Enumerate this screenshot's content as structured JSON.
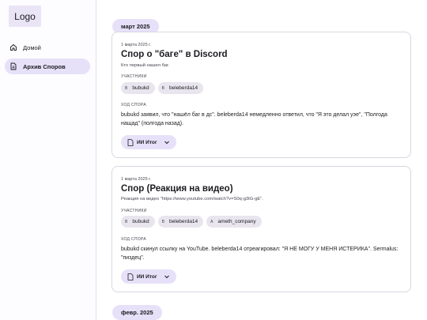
{
  "sidebar": {
    "logo": "Logo",
    "items": [
      {
        "label": "Домой",
        "icon": "home-icon"
      },
      {
        "label": "Архив Споров",
        "icon": "document-icon"
      }
    ]
  },
  "months": [
    "март 2025",
    "февр. 2025"
  ],
  "cards": [
    {
      "date": "1 марта 2025 г.",
      "title": "Спор о \"баге\" в Discord",
      "subtitle": "Кто первый нашел баг.",
      "participants_label": "УЧАСТНИКИ",
      "participants": [
        {
          "initial": "B",
          "name": "bubukd"
        },
        {
          "initial": "B",
          "name": "beleberda14"
        }
      ],
      "progress_label": "ХОД СПОРА",
      "body": "bubukd заявил, что \"нашёл баг в дс\". beleberda14 немедленно ответил, что \"Я это делал уэе\", \"Полгода нащад\" (полгода назад).",
      "ai_button": "ИИ Итог"
    },
    {
      "date": "1 марта 2025 г.",
      "title": "Спор (Реакция на видео)",
      "subtitle": "Реакция на видео \"https://www.youtube.com/watch?v=S0q-g3tG-gE\".",
      "participants_label": "УЧАСТНИКИ",
      "participants": [
        {
          "initial": "B",
          "name": "bubukd"
        },
        {
          "initial": "B",
          "name": "beleberda14"
        },
        {
          "initial": "A",
          "name": "ameth_company"
        }
      ],
      "progress_label": "ХОД СПОРА",
      "body": "bubukd скинул ссылку на YouTube. beleberda14 отреагировал: \"Я НЕ МОГУ У МЕНЯ ИСТЕРИКА\". Sermalus: \"пиздец\".",
      "ai_button": "ИИ Итог"
    }
  ],
  "colors": {
    "accent_chip": "#e6e1f8",
    "participant_chip": "#e8e5ee",
    "card_border": "#d9d6e0"
  }
}
